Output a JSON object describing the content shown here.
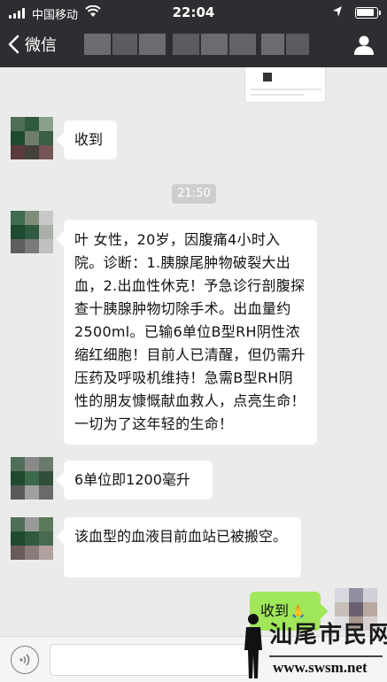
{
  "status_bar": {
    "carrier": "中国移动",
    "time": "22:04"
  },
  "nav": {
    "back_label": "微信"
  },
  "colors": {
    "nav_background": "#2e2e32",
    "chat_background": "#ebebeb",
    "bubble_received": "#ffffff",
    "bubble_sent": "#a0e75a"
  },
  "messages": [
    {
      "side": "received",
      "text": "收到"
    },
    {
      "side": "received",
      "text": "叶 女性，20岁，因腹痛4小时入院。诊断：1.胰腺尾肿物破裂大出血，2.出血性休克！予急诊行剖腹探查十胰腺肿物切除手术。出血量约2500ml。已输6单位B型RH阴性浓缩红细胞！目前人已清醒，但仍需升压药及呼吸机维持！急需B型RH阴性的朋友慷慨献血救人，点亮生命！一切为了这年轻的生命！"
    },
    {
      "side": "received",
      "text": "6单位即1200毫升"
    },
    {
      "side": "received",
      "text": "该血型的血液目前血站已被搬空。"
    },
    {
      "side": "sent",
      "text": "收到",
      "emoji": "🙏"
    }
  ],
  "timestamp": "21:50",
  "watermark": {
    "name": "汕尾市民网",
    "url": "www.swsm.net"
  }
}
